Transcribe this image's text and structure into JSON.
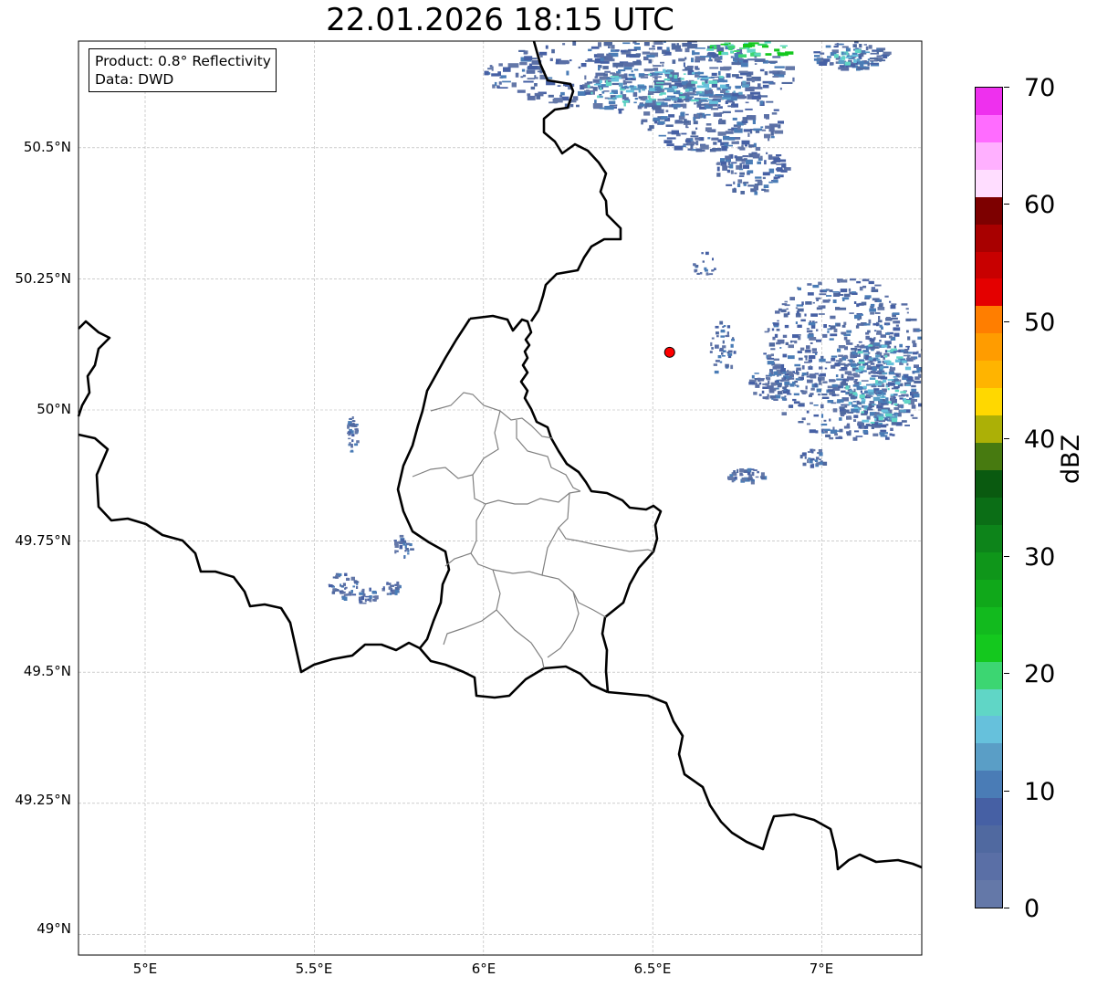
{
  "title": "22.01.2026 18:15 UTC",
  "info": {
    "product": "Product: 0.8° Reflectivity",
    "source": "Data: DWD"
  },
  "axes": {
    "lon_ticks": [
      "5°E",
      "5.5°E",
      "6°E",
      "6.5°E",
      "7°E"
    ],
    "lat_ticks": [
      "50.5°N",
      "50.25°N",
      "50°N",
      "49.75°N",
      "49.5°N",
      "49.25°N",
      "49°N"
    ],
    "grid": "on",
    "lon_range": [
      4.8,
      7.3
    ],
    "lat_range": [
      48.95,
      50.7
    ]
  },
  "colorbar": {
    "unit": "dBZ",
    "ticks": [
      "0",
      "10",
      "20",
      "30",
      "40",
      "50",
      "60",
      "70"
    ],
    "range": [
      0,
      70
    ],
    "step": 2.5,
    "colors": [
      "#6478a8",
      "#5a6fa6",
      "#5069a0",
      "#4660a4",
      "#4a7cb6",
      "#5a9ec6",
      "#66c1dc",
      "#60d6c6",
      "#3cd672",
      "#14c81e",
      "#12ba1e",
      "#10a81a",
      "#0f961a",
      "#0d841a",
      "#0b6e16",
      "#0a5a10",
      "#477a10",
      "#acb006",
      "#ffd800",
      "#ffb400",
      "#ff9c00",
      "#ff7e00",
      "#e40000",
      "#c80000",
      "#a80000",
      "#7d0000",
      "#ffddff",
      "#ffb0ff",
      "#ff6cff",
      "#ee30ee"
    ]
  },
  "marker": {
    "name": "radar-site-marker",
    "lon": 6.55,
    "lat": 50.11,
    "color": "#ff0000"
  }
}
